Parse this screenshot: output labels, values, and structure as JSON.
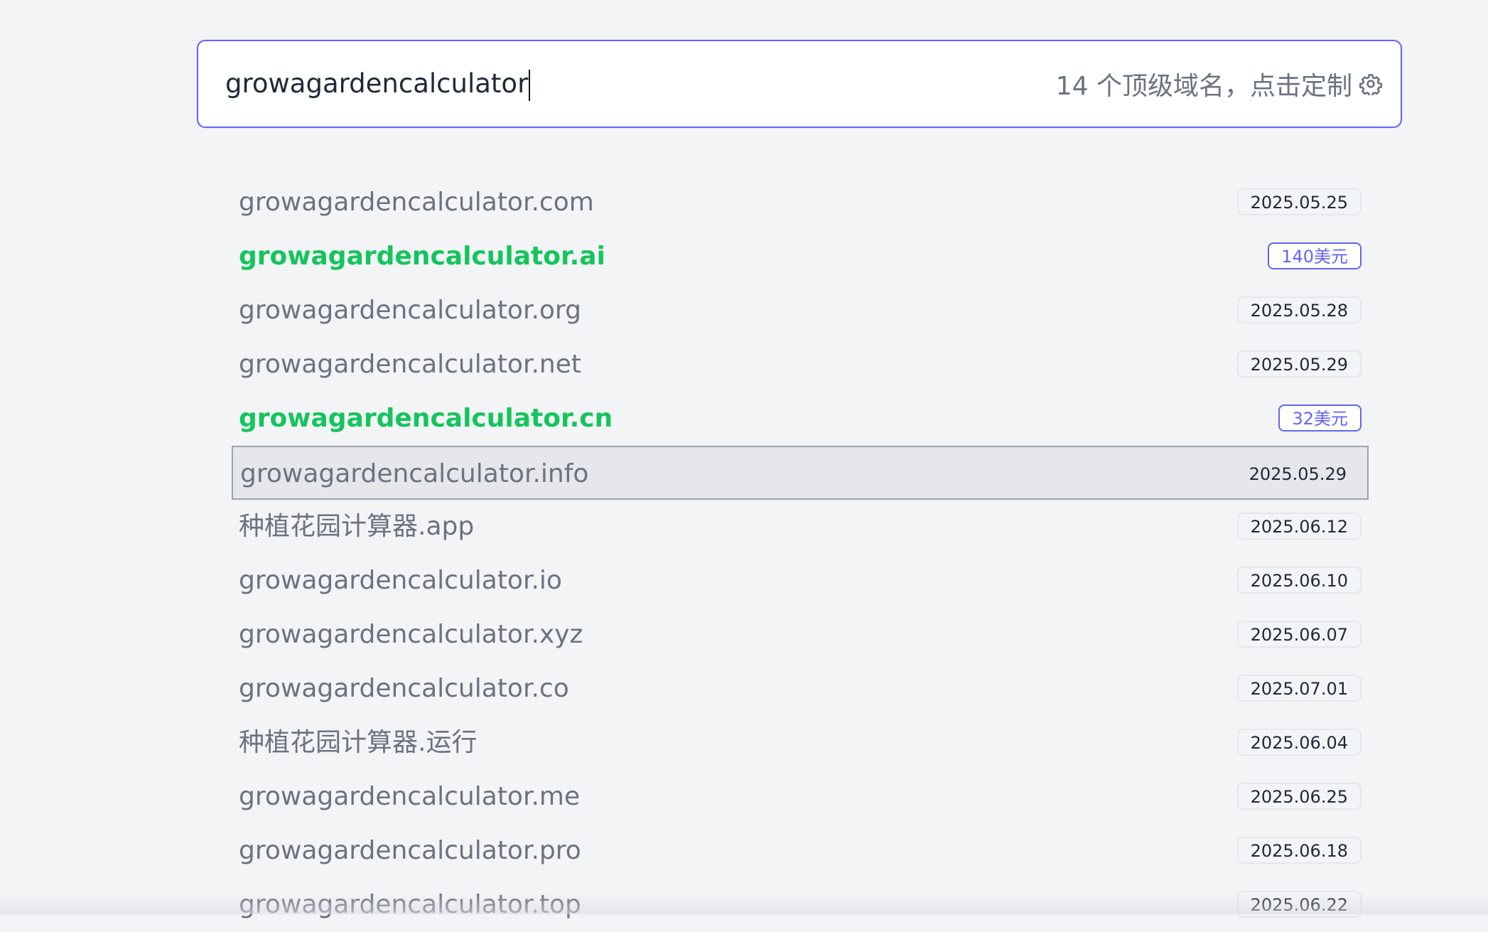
{
  "search": {
    "value": "growagardencalculator",
    "tld_config_label": "14 个顶级域名，点击定制"
  },
  "results": [
    {
      "domain": "growagardencalculator.com",
      "status": "registered",
      "tag": "2025.05.25"
    },
    {
      "domain": "growagardencalculator.ai",
      "status": "available",
      "tag": "140美元"
    },
    {
      "domain": "growagardencalculator.org",
      "status": "registered",
      "tag": "2025.05.28"
    },
    {
      "domain": "growagardencalculator.net",
      "status": "registered",
      "tag": "2025.05.29"
    },
    {
      "domain": "growagardencalculator.cn",
      "status": "available",
      "tag": "32美元"
    },
    {
      "domain": "growagardencalculator.info",
      "status": "registered",
      "tag": "2025.05.29",
      "selected": true
    },
    {
      "domain": "种植花园计算器.app",
      "status": "registered",
      "tag": "2025.06.12"
    },
    {
      "domain": "growagardencalculator.io",
      "status": "registered",
      "tag": "2025.06.10"
    },
    {
      "domain": "growagardencalculator.xyz",
      "status": "registered",
      "tag": "2025.06.07"
    },
    {
      "domain": "growagardencalculator.co",
      "status": "registered",
      "tag": "2025.07.01"
    },
    {
      "domain": "种植花园计算器.运行",
      "status": "registered",
      "tag": "2025.06.04"
    },
    {
      "domain": "growagardencalculator.me",
      "status": "registered",
      "tag": "2025.06.25"
    },
    {
      "domain": "growagardencalculator.pro",
      "status": "registered",
      "tag": "2025.06.18"
    },
    {
      "domain": "growagardencalculator.top",
      "status": "registered",
      "tag": "2025.06.22"
    }
  ],
  "colors": {
    "accent": "#6366f1",
    "available": "#16c45e",
    "registered_text": "#6b7280",
    "background": "#f3f4f6"
  },
  "icons": {
    "tld_config": "gear-icon"
  }
}
